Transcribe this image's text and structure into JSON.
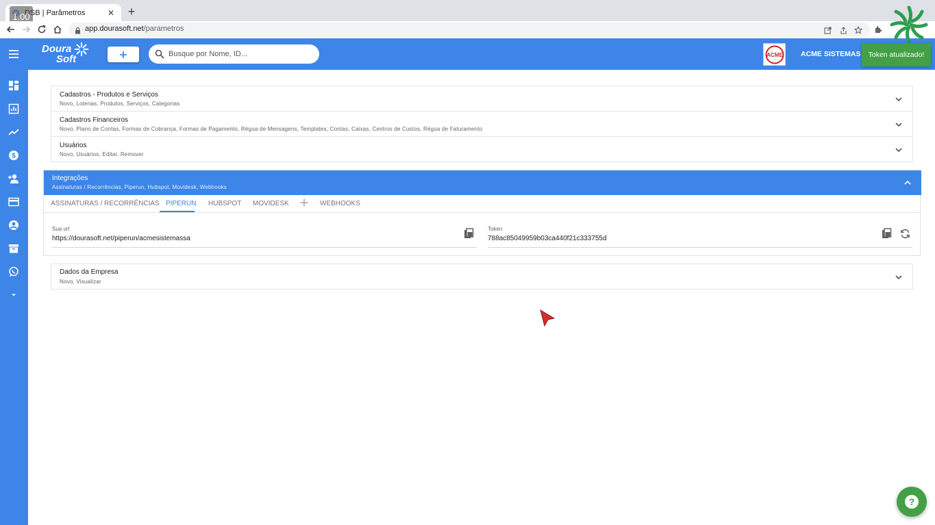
{
  "browser": {
    "tab_title": "DSB | Parâmetros",
    "zoom_badge": "1.00",
    "url_host": "app.dourasoft.net",
    "url_path": "/parametros"
  },
  "app": {
    "logo_line1": "Doura",
    "logo_line2": "Soft",
    "search_placeholder": "Busque por Nome, ID...",
    "company_logo_text": "ACME",
    "company_name": "ACME SISTEMAS S.",
    "snackbar": "Token atualizado!"
  },
  "sections": [
    {
      "title": "Cadastros - Produtos e Serviços",
      "subtitle": "Novo, Loterias, Produtos, Serviços, Categorias"
    },
    {
      "title": "Cadastros Financeiros",
      "subtitle": "Novo, Plano de Contas, Formas de Cobrança, Formas de Pagamento, Régua de Mensagens, Templates, Contas, Caixas, Centros de Custos, Régua de Faturamento"
    },
    {
      "title": "Usuários",
      "subtitle": "Novo, Usuários, Editar, Remover"
    }
  ],
  "integrations": {
    "title": "Integrações",
    "subtitle": "Assinaturas / Recorrências, Piperun, Hubspot, Movidesk, Webhooks",
    "tabs": [
      "ASSINATURAS / RECORRÊNCIAS",
      "PIPERUN",
      "HUBSPOT",
      "MOVIDESK",
      "WEBHOOKS"
    ],
    "active_tab": "PIPERUN",
    "url_label": "Sua url",
    "url_value": "https://dourasoft.net/piperun/acmesistemassa",
    "token_label": "Token",
    "token_value": "788ac85049959b03ca440f21c333755d"
  },
  "company_section": {
    "title": "Dados da Empresa",
    "subtitle": "Novo, Visualizar"
  },
  "colors": {
    "primary": "#3d86e8",
    "success": "#43a047",
    "tab_active": "#3d7ede"
  }
}
